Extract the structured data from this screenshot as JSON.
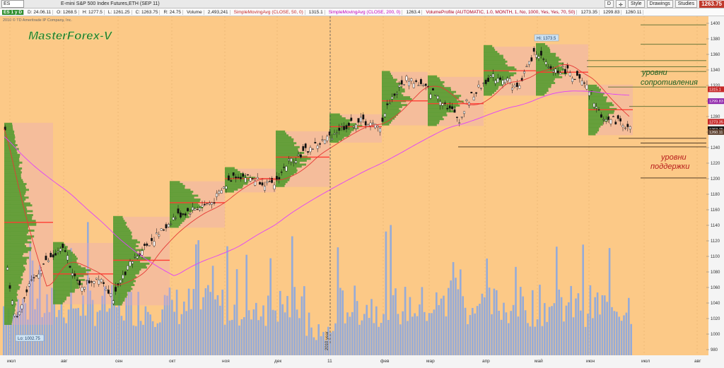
{
  "toolbar": {
    "symbol": "ES",
    "title": "E-mini S&P 500 Index Futures,ETH (SEP 11)",
    "period": "D",
    "style_label": "Style",
    "drawings_label": "Drawings",
    "studies_label": "Studies",
    "last_price": "1263.75"
  },
  "status": {
    "symbol_tf": "ES 1 y D",
    "date": "D: 24.06.11",
    "open": "O: 1268.5",
    "high": "H: 1277.5",
    "low": "L: 1261.25",
    "close": "C: 1263.75",
    "range": "R: 24.75",
    "volume_label": "Volume",
    "volume": "2,493,241",
    "sma50": "SimpleMovingAvg (CLOSE, 50, 0)",
    "sma50_val": "1315.1",
    "sma200": "SimpleMovingAvg (CLOSE, 200, 0)",
    "sma200_val": "1263.4",
    "vp": "VolumeProfile (AUTOMATIC, 1.0, MONTH, 1, No, 1000, Yes, Yes, 70, 50)",
    "vp1": "1273.35",
    "vp2": "1299.83",
    "vp3": "1260.11"
  },
  "chart": {
    "copyright": "2010 © TD Ameritrade IP Company, Inc.",
    "watermark": "MasterForex-V",
    "hi_label": "Hi: 1373.5",
    "lo_label": "Lo: 1002.75",
    "year_label": "2010 year",
    "resistance_label_1": "уровни",
    "resistance_label_2": "сопротивления",
    "support_label_1": "уровни",
    "support_label_2": "поддержки",
    "months": [
      "июл",
      "авг",
      "сен",
      "окт",
      "ноя",
      "дек",
      "11",
      "фев",
      "мар",
      "апр",
      "май",
      "июн",
      "июл",
      "авг"
    ],
    "price_ticks": [
      "1400",
      "1380",
      "1360",
      "1340",
      "1320",
      "1300",
      "1280",
      "1260",
      "1240",
      "1220",
      "1200",
      "1180",
      "1160",
      "1140",
      "1120",
      "1100",
      "1080",
      "1060",
      "1040",
      "1020",
      "1000",
      "980"
    ],
    "price_badges": [
      "1315.1",
      "1299.83",
      "1273.35",
      "1263.75",
      "1260.11"
    ],
    "colors": {
      "bg": "#fcc987",
      "volume": "#8faadc",
      "up": "#ffffff",
      "down": "#111111",
      "sma50": "#e53935",
      "sma200": "#e040fb",
      "vp_green": "#4c9a2a",
      "vp_pink": "#e8a7bf"
    }
  }
}
